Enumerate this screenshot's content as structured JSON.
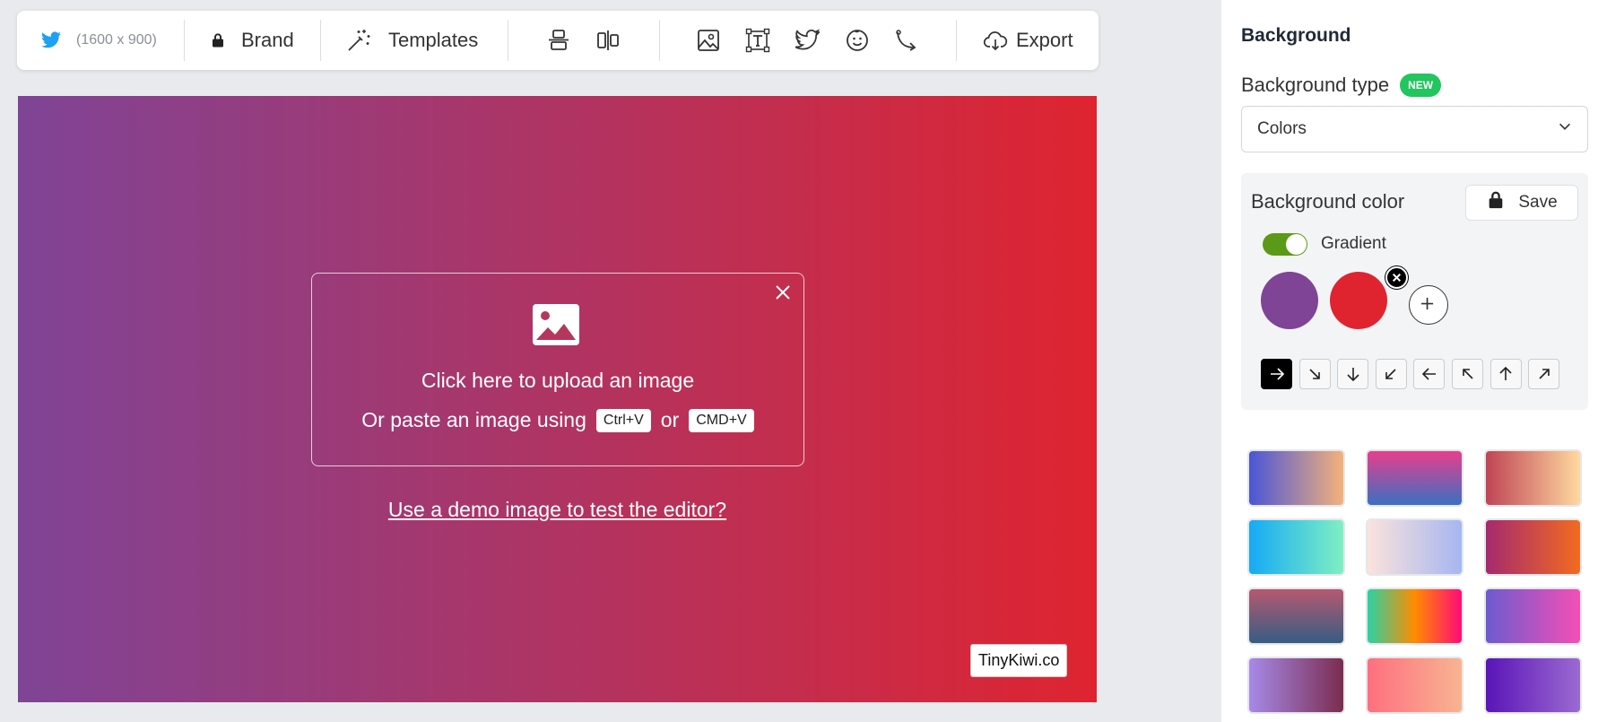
{
  "toolbar": {
    "size_label": "(1600 x 900)",
    "brand_label": "Brand",
    "templates_label": "Templates",
    "export_label": "Export",
    "icons": [
      "twitter-icon",
      "lock-icon",
      "magic-wand-icon",
      "align-vertical-icon",
      "align-horizontal-icon",
      "image-icon",
      "text-icon",
      "twitter-outline-icon",
      "emoji-icon",
      "arrow-icon",
      "cloud-download-icon"
    ]
  },
  "canvas": {
    "gradient": {
      "from": "#7f4496",
      "to": "#df2430",
      "direction": "to right"
    },
    "upload": {
      "line1": "Click here to upload an image",
      "line2_prefix": "Or paste an image using",
      "shortcut1": "Ctrl+V",
      "or": "or",
      "shortcut2": "CMD+V"
    },
    "demo_link": "Use a demo image to test the editor?",
    "watermark": "TinyKiwi.co"
  },
  "panel": {
    "title": "Background",
    "bg_type_label": "Background type",
    "new_badge": "NEW",
    "bg_type_value": "Colors",
    "bg_color_label": "Background color",
    "save_label": "Save",
    "gradient_label": "Gradient",
    "gradient_enabled": true,
    "colors": [
      "#7f4496",
      "#df2430"
    ],
    "directions": [
      "right",
      "down-right",
      "down",
      "down-left",
      "left",
      "up-left",
      "up",
      "up-right"
    ],
    "active_direction": "right",
    "presets": [
      [
        "#4a55d6",
        "#f4b27a"
      ],
      [
        "#e83e8c",
        "#3b6fc1"
      ],
      [
        "#c04455",
        "#ffd9a0"
      ],
      [
        "#16aaf5",
        "#7ef0c2"
      ],
      [
        "#fbe3dc",
        "#a6b6f0"
      ],
      [
        "#a52a6e",
        "#f26b1f"
      ],
      [
        "#b5596f",
        "#365d83"
      ],
      [
        "#2ad2a4",
        "#ff8c00",
        "#ff0a78"
      ],
      [
        "#6c5bd0",
        "#f44fb5"
      ],
      [
        "#a68ae8",
        "#7b2c4f"
      ],
      [
        "#ff6f7f",
        "#f8b492"
      ],
      [
        "#5a14b8",
        "#9b6ad1"
      ]
    ]
  }
}
